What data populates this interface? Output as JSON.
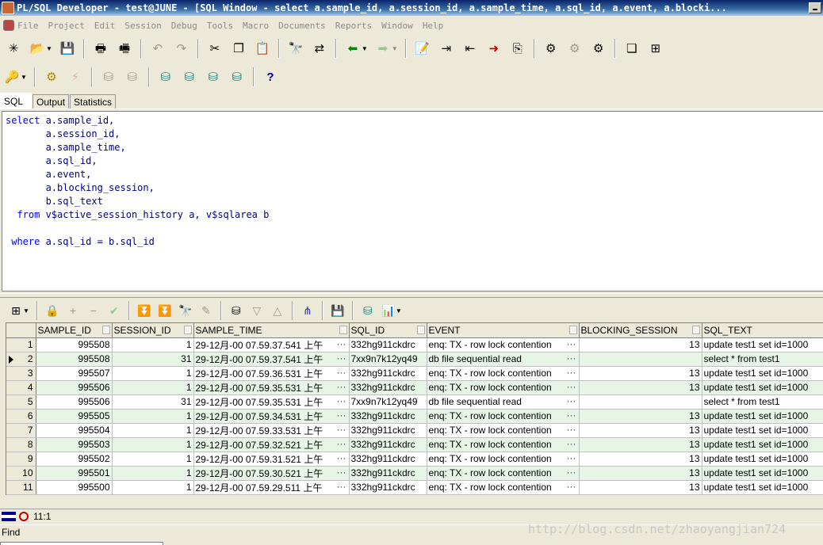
{
  "window": {
    "title": "PL/SQL Developer - test@JUNE - [SQL Window - select a.sample_id, a.session_id, a.sample_time, a.sql_id, a.event, a.blocki..."
  },
  "menu": [
    "File",
    "Project",
    "Edit",
    "Session",
    "Debug",
    "Tools",
    "Macro",
    "Documents",
    "Reports",
    "Window",
    "Help"
  ],
  "toolbar1_icons": [
    "new-icon",
    "open-icon",
    "save-icon",
    "print-icon",
    "print-setup-icon",
    "undo-icon",
    "redo-icon",
    "cut-icon",
    "copy-icon",
    "paste-icon",
    "find-icon",
    "replace-icon",
    "back-icon",
    "forward-icon",
    "toggle-comment-icon",
    "indent-icon",
    "unindent-icon",
    "uppercase-icon",
    "lowercase-icon",
    "execute-script-icon",
    "break-icon",
    "explain-icon",
    "cascade-icon",
    "tile-icon"
  ],
  "toolbar2_icons": [
    "key-icon",
    "compile-icon",
    "stop-icon",
    "commit-icon",
    "rollback-icon",
    "session-db-icon",
    "sql-icon",
    "db-lock-icon",
    "db-refresh-icon",
    "help-icon"
  ],
  "tabs": [
    "SQL",
    "Output",
    "Statistics"
  ],
  "active_tab": "SQL",
  "editor": {
    "lines": [
      {
        "kw": "select",
        "rest": " a.sample_id,"
      },
      {
        "kw": "",
        "rest": "       a.session_id,"
      },
      {
        "kw": "",
        "rest": "       a.sample_time,"
      },
      {
        "kw": "",
        "rest": "       a.sql_id,"
      },
      {
        "kw": "",
        "rest": "       a.event,"
      },
      {
        "kw": "",
        "rest": "       a.blocking_session,"
      },
      {
        "kw": "",
        "rest": "       b.sql_text"
      },
      {
        "kw": "  from",
        "rest": " v$active_session_history a, v$sqlarea b"
      },
      {
        "kw": "",
        "rest": ""
      },
      {
        "kw": " where",
        "rest": " a.sql_id = b.sql_id"
      }
    ]
  },
  "grid": {
    "columns": [
      "SAMPLE_ID",
      "SESSION_ID",
      "SAMPLE_TIME",
      "SQL_ID",
      "EVENT",
      "BLOCKING_SESSION",
      "SQL_TEXT"
    ],
    "current_row": 2,
    "ellipsis": "···",
    "rows": [
      {
        "n": "1",
        "sample_id": "995508",
        "session_id": "1",
        "sample_time": "29-12月-00 07.59.37.541 上午",
        "sql_id": "332hg911ckdrc",
        "event": "enq: TX - row lock contention",
        "blocking_session": "13",
        "sql_text": "update test1 set id=1000"
      },
      {
        "n": "2",
        "sample_id": "995508",
        "session_id": "31",
        "sample_time": "29-12月-00 07.59.37.541 上午",
        "sql_id": "7xx9n7k12yq49",
        "event": "db file sequential read",
        "blocking_session": "",
        "sql_text": "select * from test1"
      },
      {
        "n": "3",
        "sample_id": "995507",
        "session_id": "1",
        "sample_time": "29-12月-00 07.59.36.531 上午",
        "sql_id": "332hg911ckdrc",
        "event": "enq: TX - row lock contention",
        "blocking_session": "13",
        "sql_text": "update test1 set id=1000"
      },
      {
        "n": "4",
        "sample_id": "995506",
        "session_id": "1",
        "sample_time": "29-12月-00 07.59.35.531 上午",
        "sql_id": "332hg911ckdrc",
        "event": "enq: TX - row lock contention",
        "blocking_session": "13",
        "sql_text": "update test1 set id=1000"
      },
      {
        "n": "5",
        "sample_id": "995506",
        "session_id": "31",
        "sample_time": "29-12月-00 07.59.35.531 上午",
        "sql_id": "7xx9n7k12yq49",
        "event": "db file sequential read",
        "blocking_session": "",
        "sql_text": "select * from test1"
      },
      {
        "n": "6",
        "sample_id": "995505",
        "session_id": "1",
        "sample_time": "29-12月-00 07.59.34.531 上午",
        "sql_id": "332hg911ckdrc",
        "event": "enq: TX - row lock contention",
        "blocking_session": "13",
        "sql_text": "update test1 set id=1000"
      },
      {
        "n": "7",
        "sample_id": "995504",
        "session_id": "1",
        "sample_time": "29-12月-00 07.59.33.531 上午",
        "sql_id": "332hg911ckdrc",
        "event": "enq: TX - row lock contention",
        "blocking_session": "13",
        "sql_text": "update test1 set id=1000"
      },
      {
        "n": "8",
        "sample_id": "995503",
        "session_id": "1",
        "sample_time": "29-12月-00 07.59.32.521 上午",
        "sql_id": "332hg911ckdrc",
        "event": "enq: TX - row lock contention",
        "blocking_session": "13",
        "sql_text": "update test1 set id=1000"
      },
      {
        "n": "9",
        "sample_id": "995502",
        "session_id": "1",
        "sample_time": "29-12月-00 07.59.31.521 上午",
        "sql_id": "332hg911ckdrc",
        "event": "enq: TX - row lock contention",
        "blocking_session": "13",
        "sql_text": "update test1 set id=1000"
      },
      {
        "n": "10",
        "sample_id": "995501",
        "session_id": "1",
        "sample_time": "29-12月-00 07.59.30.521 上午",
        "sql_id": "332hg911ckdrc",
        "event": "enq: TX - row lock contention",
        "blocking_session": "13",
        "sql_text": "update test1 set id=1000"
      },
      {
        "n": "11",
        "sample_id": "995500",
        "session_id": "1",
        "sample_time": "29-12月-00 07.59.29.511 上午",
        "sql_id": "332hg911ckdrc",
        "event": "enq: TX - row lock contention",
        "blocking_session": "13",
        "sql_text": "update test1 set id=1000"
      }
    ]
  },
  "status": {
    "position": "11:1"
  },
  "find": {
    "label": "Find"
  },
  "watermark": "http://blog.csdn.net/zhaoyangjian724",
  "colors": {
    "title_bar": "#0a246a",
    "row_alt": "#e6f5e6",
    "keyword": "#0000ff",
    "identifier": "#000080"
  }
}
